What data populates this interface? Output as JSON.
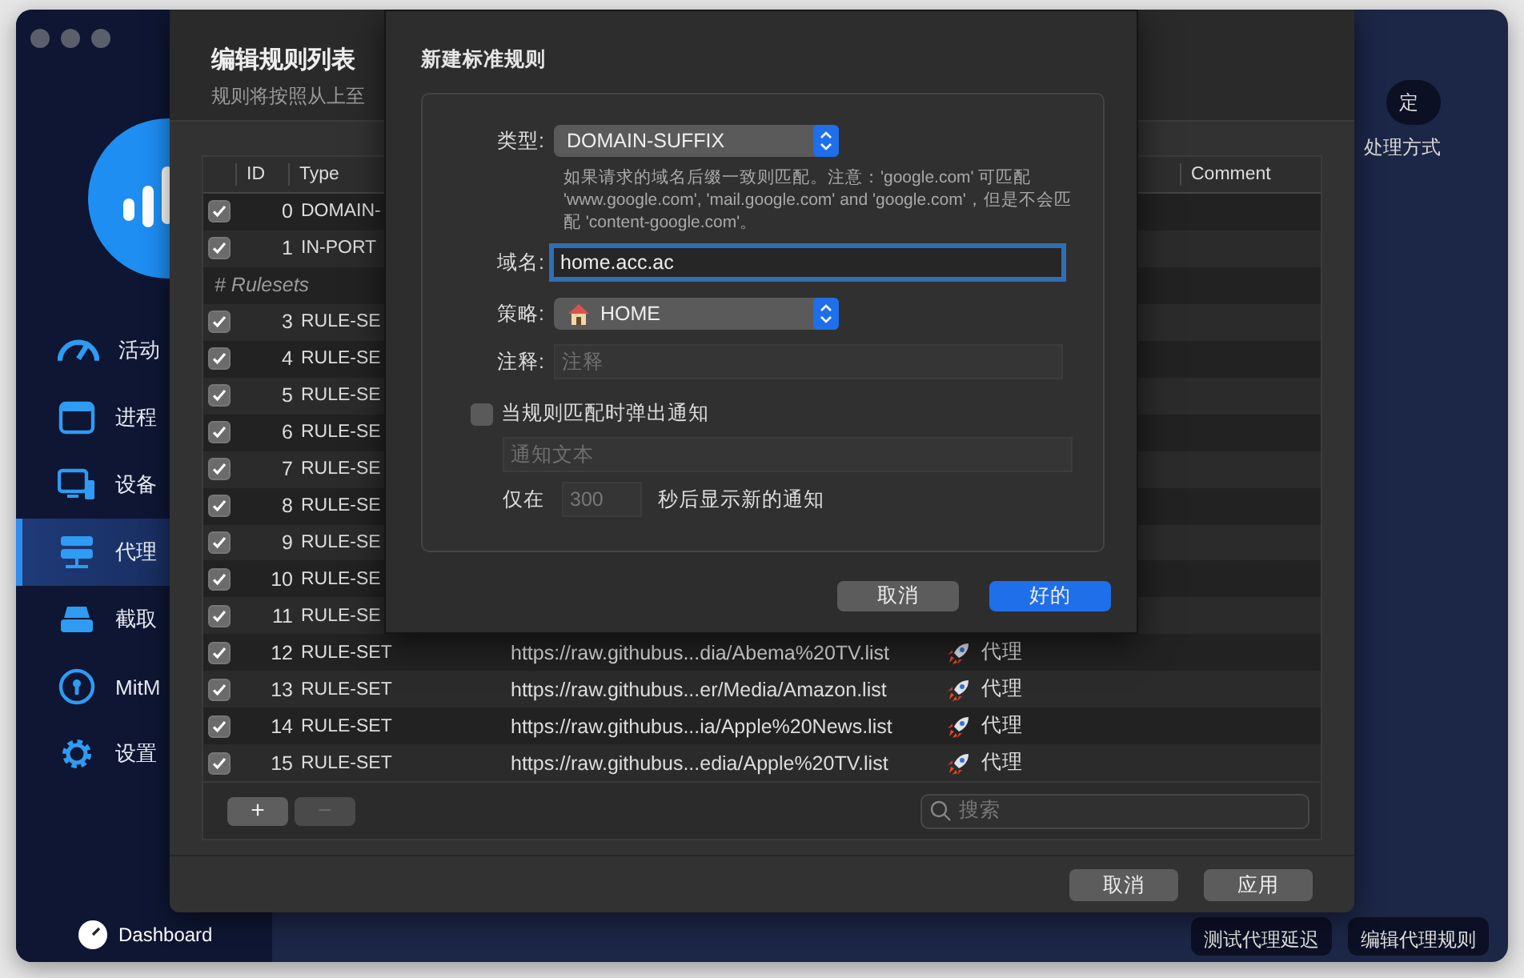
{
  "sidebar": {
    "items": [
      {
        "label": "活动",
        "kind": "gauge",
        "selected": false
      },
      {
        "label": "进程",
        "kind": "window",
        "selected": false
      },
      {
        "label": "设备",
        "kind": "devices",
        "selected": false
      },
      {
        "label": "代理",
        "kind": "server",
        "selected": true
      },
      {
        "label": "截取",
        "kind": "drive",
        "selected": false
      },
      {
        "label": "MitM",
        "kind": "keyhole",
        "selected": false
      },
      {
        "label": "设置",
        "kind": "gear",
        "selected": false
      }
    ],
    "dashboard": "Dashboard"
  },
  "main": {
    "primary_button": "定",
    "hint": "处理方式",
    "actions": [
      "测试代理延迟",
      "编辑代理规则"
    ]
  },
  "sheet": {
    "title": "编辑规则列表",
    "subtitle": "规则将按照从上至",
    "columns": [
      "ID",
      "Type",
      "Comment"
    ],
    "rows": [
      {
        "kind": "rule",
        "checked": true,
        "id": "0",
        "type": "DOMAIN-"
      },
      {
        "kind": "rule",
        "checked": true,
        "id": "1",
        "type": "IN-PORT"
      },
      {
        "kind": "group",
        "label": "# Rulesets"
      },
      {
        "kind": "rule",
        "checked": true,
        "id": "3",
        "type": "RULE-SE"
      },
      {
        "kind": "rule",
        "checked": true,
        "id": "4",
        "type": "RULE-SE"
      },
      {
        "kind": "rule",
        "checked": true,
        "id": "5",
        "type": "RULE-SE"
      },
      {
        "kind": "rule",
        "checked": true,
        "id": "6",
        "type": "RULE-SE"
      },
      {
        "kind": "rule",
        "checked": true,
        "id": "7",
        "type": "RULE-SE"
      },
      {
        "kind": "rule",
        "checked": true,
        "id": "8",
        "type": "RULE-SE"
      },
      {
        "kind": "rule",
        "checked": true,
        "id": "9",
        "type": "RULE-SE"
      },
      {
        "kind": "rule",
        "checked": true,
        "id": "10",
        "type": "RULE-SE"
      },
      {
        "kind": "rule",
        "checked": true,
        "id": "11",
        "type": "RULE-SE"
      },
      {
        "kind": "rule",
        "checked": true,
        "id": "12",
        "type": "RULE-SET",
        "value": "https://raw.githubus...dia/Abema%20TV.list",
        "policy": "代理"
      },
      {
        "kind": "rule",
        "checked": true,
        "id": "13",
        "type": "RULE-SET",
        "value": "https://raw.githubus...er/Media/Amazon.list",
        "policy": "代理"
      },
      {
        "kind": "rule",
        "checked": true,
        "id": "14",
        "type": "RULE-SET",
        "value": "https://raw.githubus...ia/Apple%20News.list",
        "policy": "代理"
      },
      {
        "kind": "rule",
        "checked": true,
        "id": "15",
        "type": "RULE-SET",
        "value": "https://raw.githubus...edia/Apple%20TV.list",
        "policy": "代理"
      }
    ],
    "add_button": "+",
    "remove_button": "−",
    "search": {
      "placeholder": "搜索"
    },
    "buttons": [
      "取消",
      "应用"
    ]
  },
  "dialog": {
    "title": "新建标准规则",
    "type_label": "类型:",
    "type_value": "DOMAIN-SUFFIX",
    "description": "如果请求的域名后缀一致则匹配。注意：'google.com' 可匹配 'www.google.com', 'mail.google.com' and 'google.com'，但是不会匹配 'content-google.com'。",
    "domain_label": "域名:",
    "domain_value": "home.acc.ac",
    "policy_label": "策略:",
    "policy_value": "HOME",
    "comment_label": "注释:",
    "comment": {
      "placeholder": "注释"
    },
    "notify": {
      "label": "当规则匹配时弹出通知",
      "checked": false,
      "text": {
        "placeholder": "通知文本"
      },
      "prefix": "仅在",
      "seconds": "300",
      "suffix": "秒后显示新的通知"
    },
    "buttons": [
      {
        "label": "取消",
        "primary": false
      },
      {
        "label": "好的",
        "primary": true
      }
    ]
  }
}
